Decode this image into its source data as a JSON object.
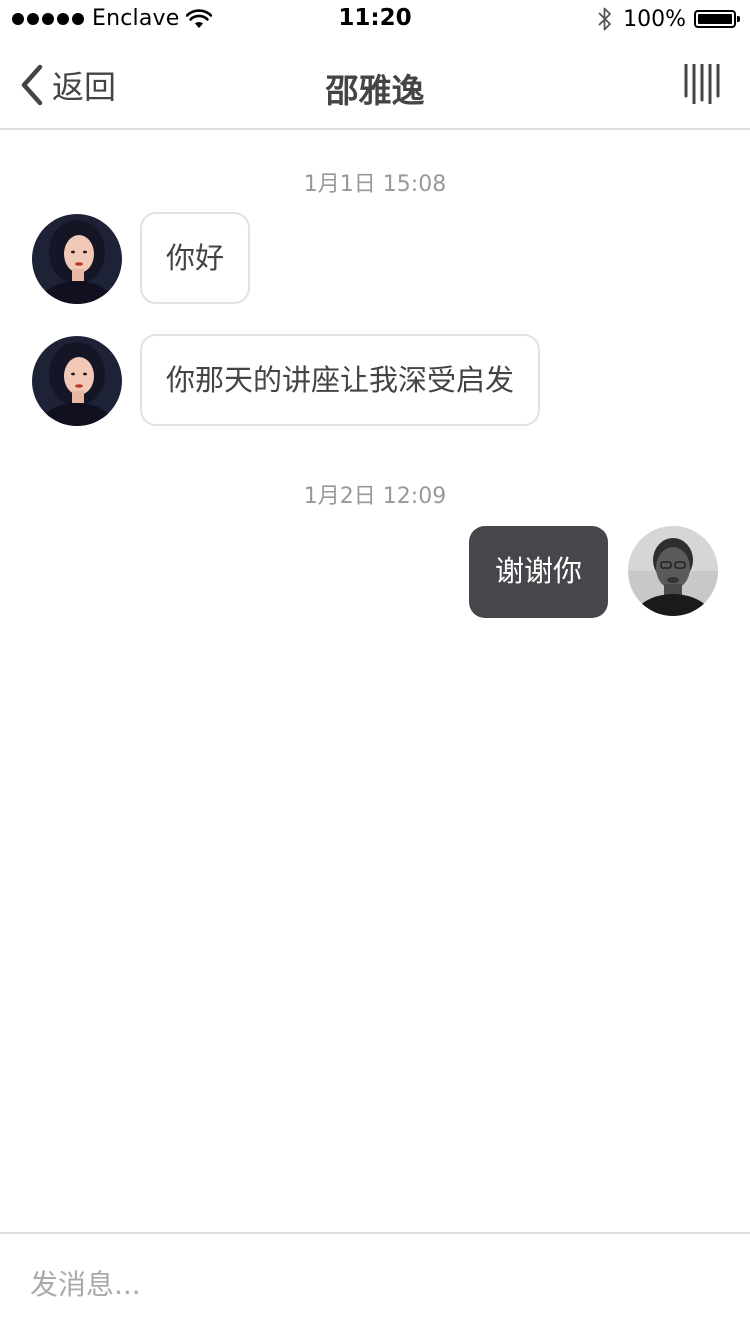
{
  "status_bar": {
    "carrier": "Enclave",
    "time": "11:20",
    "battery": "100%",
    "battery_level": 1.0,
    "icons": [
      "signal-dots-icon",
      "wifi-icon",
      "bluetooth-icon",
      "battery-icon"
    ]
  },
  "header": {
    "back_label": "返回",
    "title": "邵雅逸",
    "back_icon": "chevron-left-icon",
    "menu_icon": "menu-lines-icon"
  },
  "messages": [
    {
      "type": "timestamp",
      "text": "1月1日 15:08"
    },
    {
      "type": "message",
      "direction": "received",
      "text": "你好"
    },
    {
      "type": "message",
      "direction": "received",
      "text": "你那天的讲座让我深受启发"
    },
    {
      "type": "timestamp",
      "text": "1月2日 12:09"
    },
    {
      "type": "message",
      "direction": "sent",
      "text": "谢谢你"
    }
  ],
  "input": {
    "placeholder": "发消息..."
  },
  "colors": {
    "sent_bubble": "#46464b",
    "received_bubble_border": "#e2e2e2",
    "timestamp_text": "#999999",
    "divider": "#dcdcdc"
  }
}
